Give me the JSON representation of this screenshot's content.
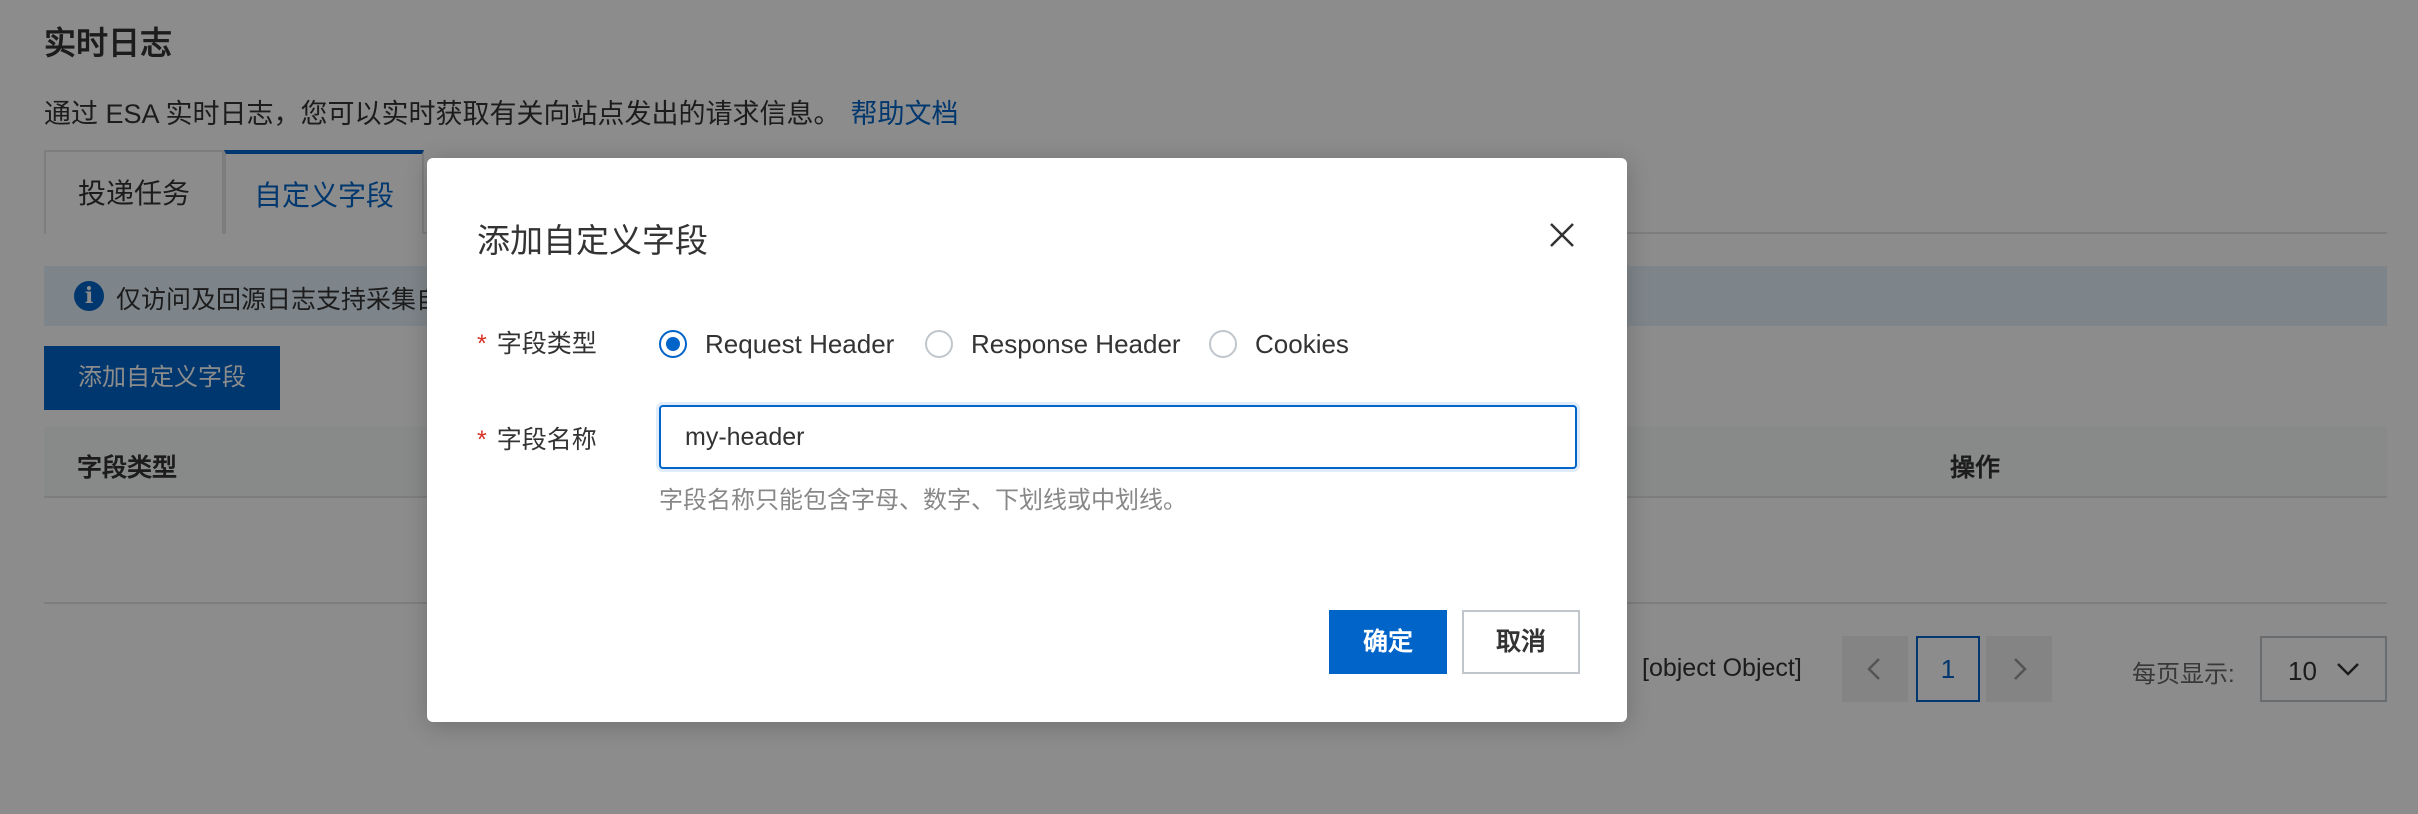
{
  "page": {
    "title": "实时日志",
    "description": "通过 ESA 实时日志，您可以实时获取有关向站点发出的请求信息。",
    "help_link": "帮助文档"
  },
  "tabs": [
    {
      "label": "投递任务",
      "active": false
    },
    {
      "label": "自定义字段",
      "active": true
    }
  ],
  "notice": {
    "text": "仅访问及回源日志支持采集自"
  },
  "toolbar": {
    "add_button": "添加自定义字段"
  },
  "table": {
    "columns": [
      "字段类型",
      "操作"
    ]
  },
  "pagination": {
    "total_text": "[object Object]",
    "current_page": "1",
    "page_size_label": "每页显示:",
    "page_size": "10"
  },
  "dialog": {
    "title": "添加自定义字段",
    "field_type_label": "字段类型",
    "field_type_options": [
      "Request Header",
      "Response Header",
      "Cookies"
    ],
    "field_type_selected": "Request Header",
    "field_name_label": "字段名称",
    "field_name_value": "my-header",
    "field_name_hint": "字段名称只能包含字母、数字、下划线或中划线。",
    "required_mark": "*",
    "ok_button": "确定",
    "cancel_button": "取消"
  },
  "colors": {
    "primary": "#0064c8",
    "required": "#d93026",
    "notice_bg": "#e6f2fc"
  },
  "icons": {
    "info": "info-icon",
    "close": "close-icon",
    "prev": "chevron-left-icon",
    "next": "chevron-right-icon",
    "dropdown": "chevron-down-icon"
  }
}
